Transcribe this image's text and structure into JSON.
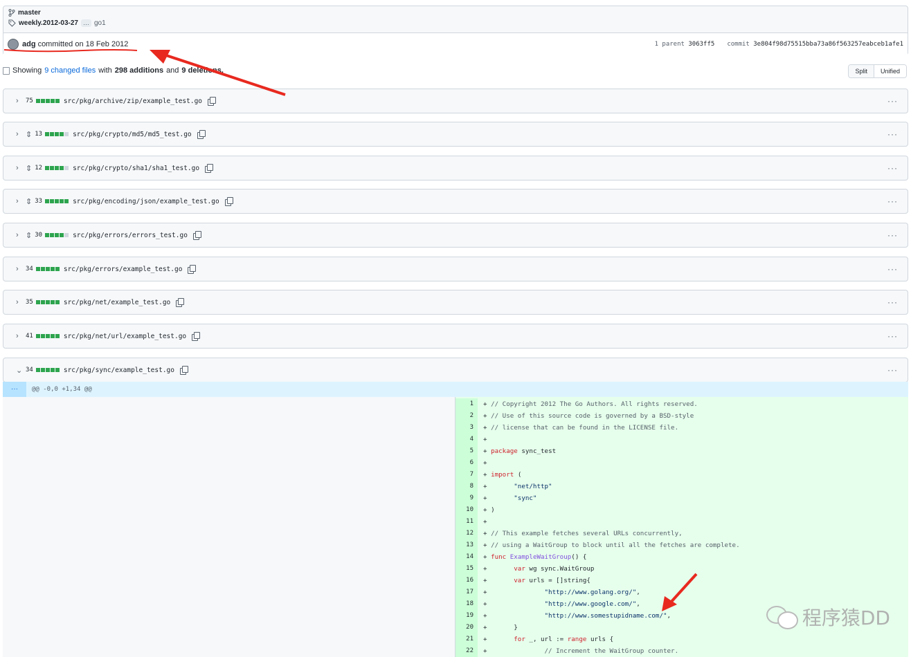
{
  "colors": {
    "add_green": "#2da44e",
    "neutral_gray": "#d0d7de",
    "link_blue": "#0969da",
    "annotation_red": "#e8291f"
  },
  "header": {
    "branch": "master",
    "tag": "weekly.2012-03-27",
    "tag_more": "…",
    "tag_extra": "go1",
    "author": "adg",
    "committed_text": "committed on 18 Feb 2012",
    "parent_label": "1 parent",
    "parent_sha": "3063ff5",
    "commit_label": "commit",
    "commit_sha": "3e804f98d75515bba73a86f563257eabceb1afe1"
  },
  "summary": {
    "showing": "Showing",
    "changed_files": "9 changed files",
    "with": "with",
    "additions": "298 additions",
    "and": "and",
    "deletions": "9 deletions."
  },
  "view_toggle": {
    "split": "Split",
    "unified": "Unified"
  },
  "files": [
    {
      "count": "75",
      "path": "src/pkg/archive/zip/example_test.go",
      "expand": false,
      "green_blocks": 5,
      "chevron": "›"
    },
    {
      "count": "13",
      "path": "src/pkg/crypto/md5/md5_test.go",
      "expand": true,
      "green_blocks": 4,
      "chevron": "›"
    },
    {
      "count": "12",
      "path": "src/pkg/crypto/sha1/sha1_test.go",
      "expand": true,
      "green_blocks": 4,
      "chevron": "›"
    },
    {
      "count": "33",
      "path": "src/pkg/encoding/json/example_test.go",
      "expand": true,
      "green_blocks": 5,
      "chevron": "›"
    },
    {
      "count": "30",
      "path": "src/pkg/errors/errors_test.go",
      "expand": true,
      "green_blocks": 4,
      "chevron": "›"
    },
    {
      "count": "34",
      "path": "src/pkg/errors/example_test.go",
      "expand": false,
      "green_blocks": 5,
      "chevron": "›"
    },
    {
      "count": "35",
      "path": "src/pkg/net/example_test.go",
      "expand": false,
      "green_blocks": 5,
      "chevron": "›"
    },
    {
      "count": "41",
      "path": "src/pkg/net/url/example_test.go",
      "expand": false,
      "green_blocks": 5,
      "chevron": "›"
    },
    {
      "count": "34",
      "path": "src/pkg/sync/example_test.go",
      "expand": false,
      "green_blocks": 5,
      "chevron": "⌄"
    }
  ],
  "hunk": {
    "expander": "···",
    "header": "@@ -0,0 +1,34 @@"
  },
  "code_lines": [
    {
      "n": "1",
      "html": "+ <span class=\"cm\">// Copyright 2012 The Go Authors. All rights reserved.</span>"
    },
    {
      "n": "2",
      "html": "+ <span class=\"cm\">// Use of this source code is governed by a BSD-style</span>"
    },
    {
      "n": "3",
      "html": "+ <span class=\"cm\">// license that can be found in the LICENSE file.</span>"
    },
    {
      "n": "4",
      "html": "+"
    },
    {
      "n": "5",
      "html": "+ <span class=\"kw\">package</span> sync_test"
    },
    {
      "n": "6",
      "html": "+"
    },
    {
      "n": "7",
      "html": "+ <span class=\"kw\">import</span> ("
    },
    {
      "n": "8",
      "html": "+       <span class=\"str\">\"net/http\"</span>"
    },
    {
      "n": "9",
      "html": "+       <span class=\"str\">\"sync\"</span>"
    },
    {
      "n": "10",
      "html": "+ )"
    },
    {
      "n": "11",
      "html": "+"
    },
    {
      "n": "12",
      "html": "+ <span class=\"cm\">// This example fetches several URLs concurrently,</span>"
    },
    {
      "n": "13",
      "html": "+ <span class=\"cm\">// using a WaitGroup to block until all the fetches are complete.</span>"
    },
    {
      "n": "14",
      "html": "+ <span class=\"kw\">func</span> <span class=\"fn\">ExampleWaitGroup</span>() {"
    },
    {
      "n": "15",
      "html": "+       <span class=\"kw\">var</span> wg sync.WaitGroup"
    },
    {
      "n": "16",
      "html": "+       <span class=\"kw\">var</span> urls = []string{"
    },
    {
      "n": "17",
      "html": "+               <span class=\"str\">\"http://www.golang.org/\"</span>,"
    },
    {
      "n": "18",
      "html": "+               <span class=\"str\">\"http://www.google.com/\"</span>,"
    },
    {
      "n": "19",
      "html": "+               <span class=\"str\">\"http://www.somestupidname.com/\"</span>,"
    },
    {
      "n": "20",
      "html": "+       }"
    },
    {
      "n": "21",
      "html": "+       <span class=\"kw\">for</span> _, url := <span class=\"kw\">range</span> urls {"
    },
    {
      "n": "22",
      "html": "+               <span class=\"cm\">// Increment the WaitGroup counter.</span>"
    }
  ],
  "watermark": "程序猿DD"
}
